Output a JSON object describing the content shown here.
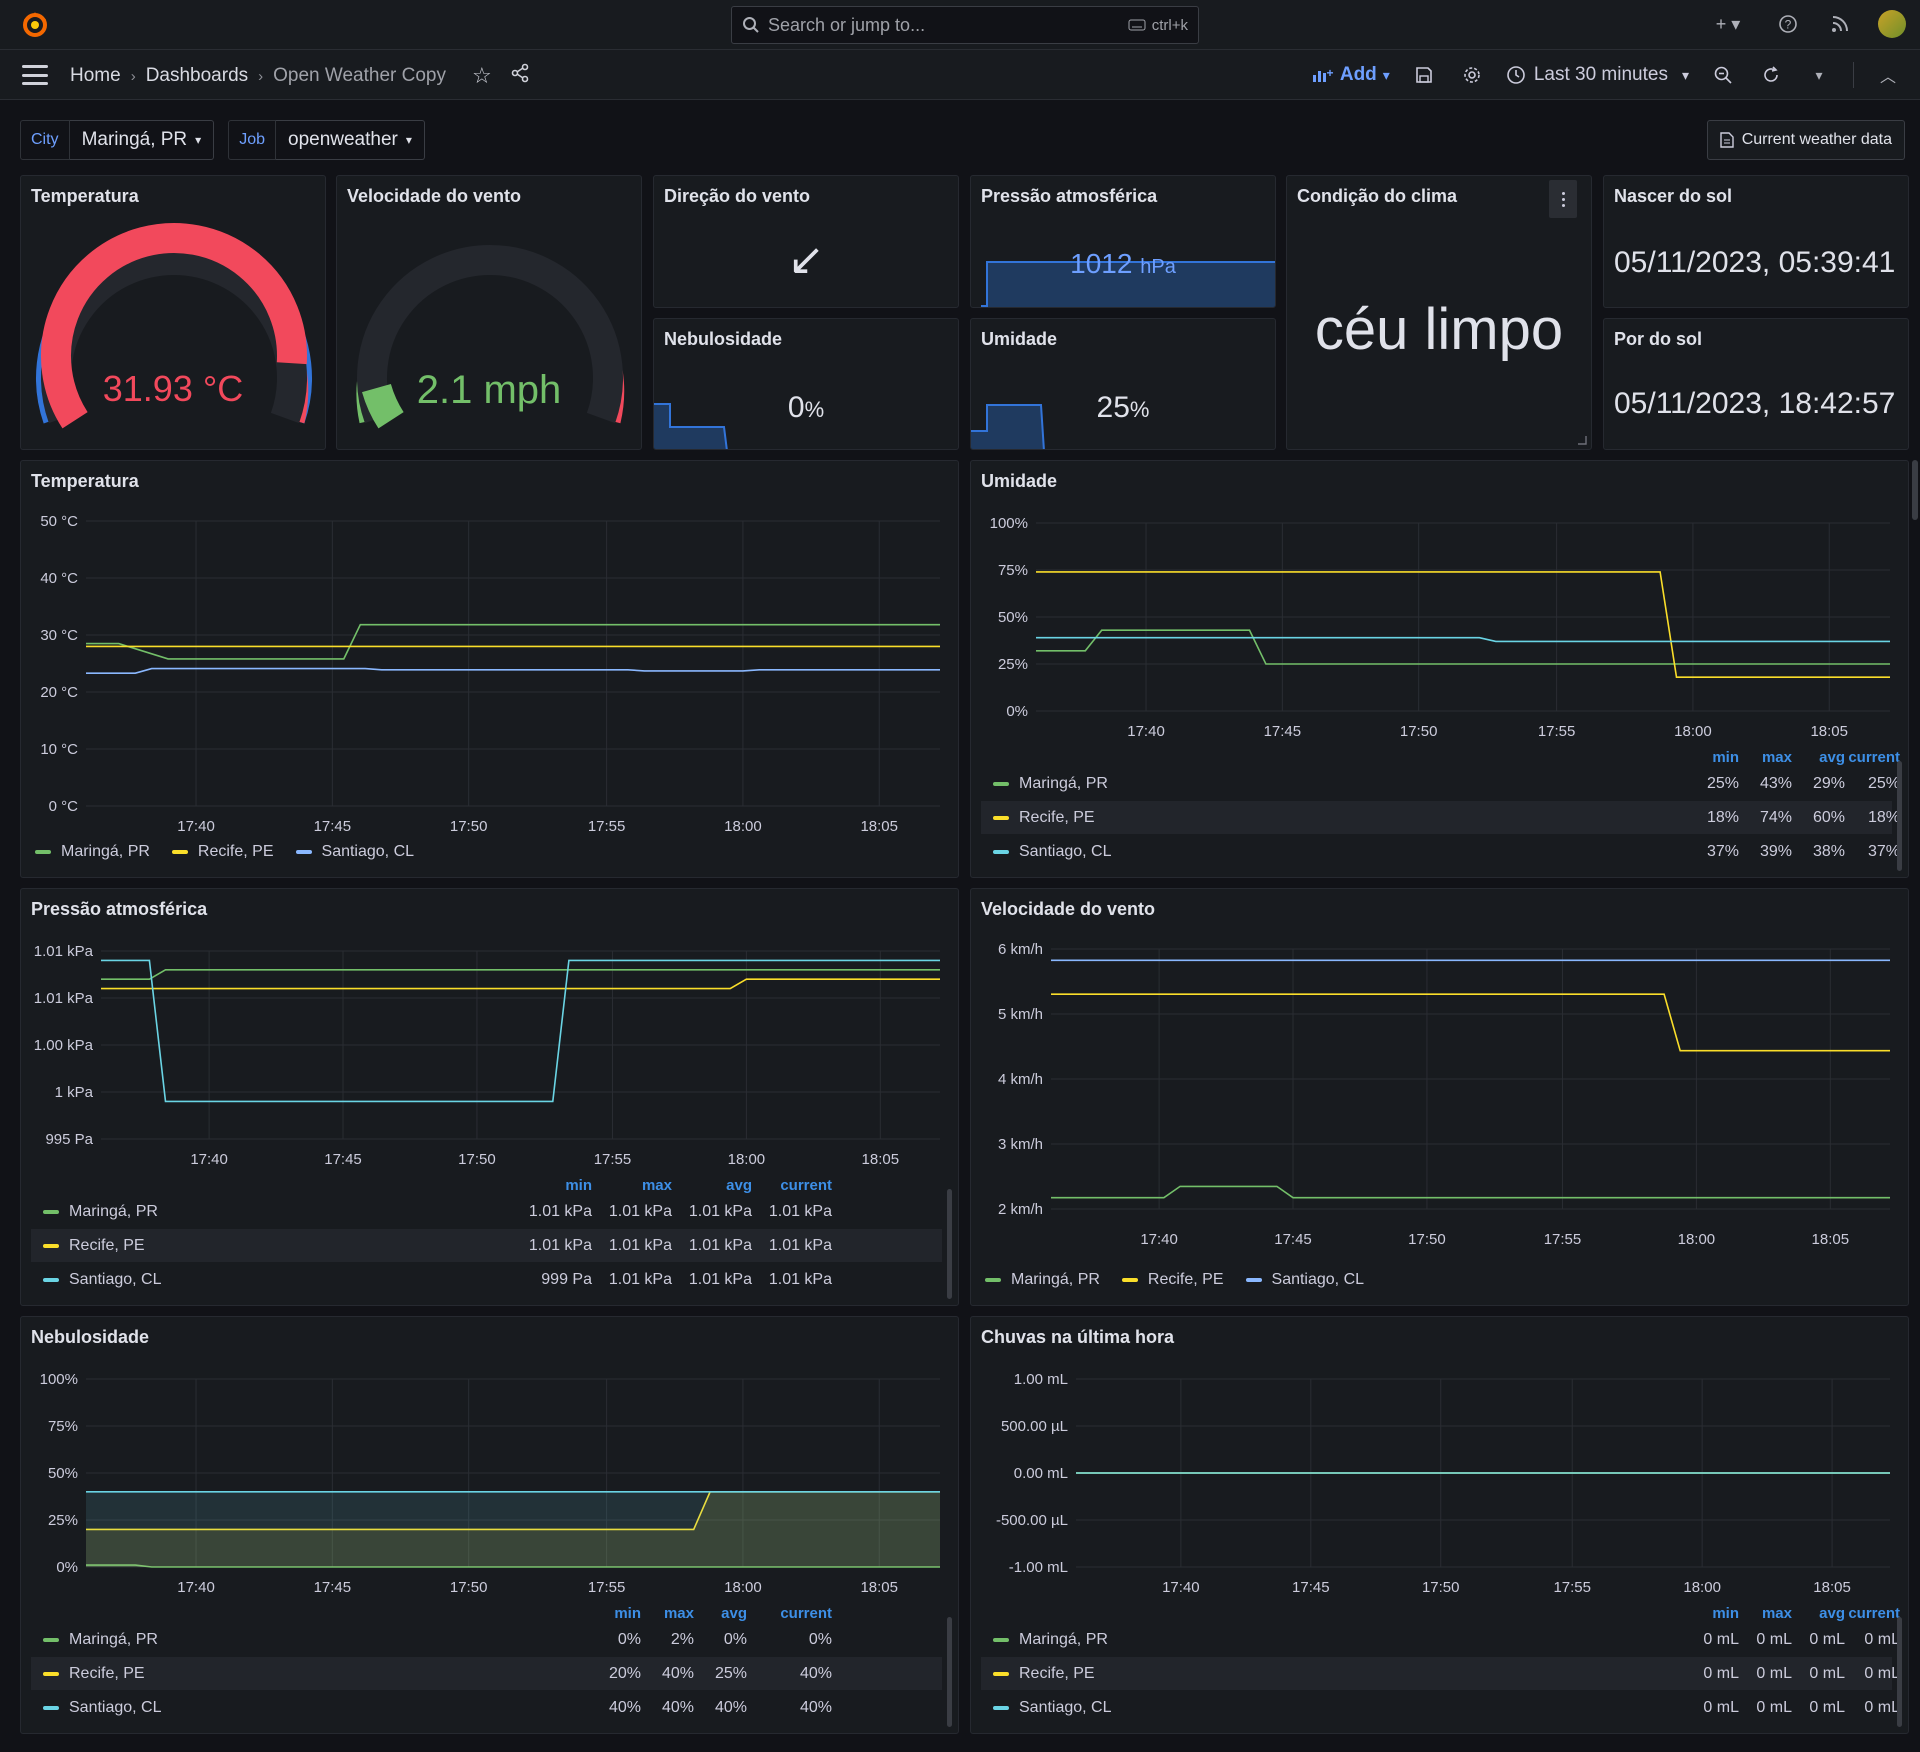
{
  "topbar": {
    "search_placeholder": "Search or jump to...",
    "search_shortcut": "ctrl+k"
  },
  "breadcrumb": {
    "home": "Home",
    "dashboards": "Dashboards",
    "current": "Open Weather Copy"
  },
  "toolbar": {
    "add_label": "Add",
    "time_range": "Last 30 minutes"
  },
  "variables": [
    {
      "label": "City",
      "value": "Maringá, PR"
    },
    {
      "label": "Job",
      "value": "openweather"
    }
  ],
  "link_button": "Current weather data",
  "panels": {
    "temp_gauge": {
      "title": "Temperatura",
      "value": "31.93 °C",
      "color": "#f2495c",
      "fraction": 0.88
    },
    "wind_gauge": {
      "title": "Velocidade do vento",
      "value": "2.1 mph",
      "color": "#73bf69",
      "fraction": 0.07
    },
    "wind_dir": {
      "title": "Direção do vento",
      "value": "↙"
    },
    "pressure_stat": {
      "title": "Pressão atmosférica",
      "value": "1012",
      "unit": "hPa"
    },
    "condition": {
      "title": "Condição do clima",
      "value": "céu limpo"
    },
    "sunrise": {
      "title": "Nascer do sol",
      "value": "05/11/2023, 05:39:41"
    },
    "cloud_stat": {
      "title": "Nebulosidade",
      "value": "0",
      "unit": "%"
    },
    "humidity_stat": {
      "title": "Umidade",
      "value": "25",
      "unit": "%"
    },
    "sunset": {
      "title": "Por do sol",
      "value": "05/11/2023, 18:42:57"
    }
  },
  "colors": {
    "green": "#73bf69",
    "yellow": "#fade2a",
    "blue": "#8ab8ff",
    "cyan": "#6ad4e4",
    "accent": "#3d8fe6"
  },
  "legend_columns": [
    "min",
    "max",
    "avg",
    "current"
  ],
  "chart_data": [
    {
      "id": "temperature",
      "type": "line",
      "title": "Temperatura",
      "x_ticks": [
        "17:40",
        "17:45",
        "17:50",
        "17:55",
        "18:00",
        "18:05"
      ],
      "y_ticks": [
        "50 °C",
        "40 °C",
        "30 °C",
        "20 °C",
        "10 °C",
        "0 °C"
      ],
      "ylim": [
        0,
        50
      ],
      "xlim": [
        17.6,
        18.12
      ],
      "series": [
        {
          "name": "Maringá, PR",
          "color": "#73bf69",
          "points": [
            [
              17.6,
              28.5
            ],
            [
              17.62,
              28.5
            ],
            [
              17.65,
              25.8
            ],
            [
              17.757,
              25.8
            ],
            [
              17.767,
              31.8
            ],
            [
              18.12,
              31.8
            ]
          ]
        },
        {
          "name": "Recife, PE",
          "color": "#fade2a",
          "points": [
            [
              17.6,
              28.0
            ],
            [
              18.12,
              28.0
            ]
          ]
        },
        {
          "name": "Santiago, CL",
          "color": "#8ab8ff",
          "points": [
            [
              17.6,
              23.3
            ],
            [
              17.63,
              23.3
            ],
            [
              17.64,
              24.1
            ],
            [
              17.77,
              24.1
            ],
            [
              17.78,
              23.9
            ],
            [
              17.93,
              23.9
            ],
            [
              17.94,
              23.7
            ],
            [
              18.0,
              23.7
            ],
            [
              18.01,
              23.9
            ],
            [
              18.12,
              23.9
            ]
          ]
        }
      ],
      "legend": [
        "Maringá, PR",
        "Recife, PE",
        "Santiago, CL"
      ]
    },
    {
      "id": "humidity",
      "type": "line",
      "title": "Umidade",
      "x_ticks": [
        "17:40",
        "17:45",
        "17:50",
        "17:55",
        "18:00",
        "18:05"
      ],
      "y_ticks": [
        "100%",
        "75%",
        "50%",
        "25%",
        "0%"
      ],
      "ylim": [
        0,
        100
      ],
      "xlim": [
        17.6,
        18.12
      ],
      "series": [
        {
          "name": "Maringá, PR",
          "color": "#73bf69",
          "points": [
            [
              17.6,
              32
            ],
            [
              17.63,
              32
            ],
            [
              17.64,
              43
            ],
            [
              17.73,
              43
            ],
            [
              17.74,
              25
            ],
            [
              18.12,
              25
            ]
          ]
        },
        {
          "name": "Recife, PE",
          "color": "#fade2a",
          "points": [
            [
              17.6,
              74
            ],
            [
              17.98,
              74
            ],
            [
              17.99,
              18
            ],
            [
              18.12,
              18
            ]
          ]
        },
        {
          "name": "Santiago, CL",
          "color": "#6ad4e4",
          "points": [
            [
              17.6,
              39
            ],
            [
              17.87,
              39
            ],
            [
              17.88,
              37
            ],
            [
              18.12,
              37
            ]
          ]
        }
      ],
      "table": [
        {
          "name": "Maringá, PR",
          "color": "#73bf69",
          "values": [
            "25%",
            "43%",
            "29%",
            "25%"
          ]
        },
        {
          "name": "Recife, PE",
          "color": "#fade2a",
          "values": [
            "18%",
            "74%",
            "60%",
            "18%"
          ]
        },
        {
          "name": "Santiago, CL",
          "color": "#6ad4e4",
          "values": [
            "37%",
            "39%",
            "38%",
            "37%"
          ]
        }
      ]
    },
    {
      "id": "pressure",
      "type": "line",
      "title": "Pressão atmosférica",
      "x_ticks": [
        "17:40",
        "17:45",
        "17:50",
        "17:55",
        "18:00",
        "18:05"
      ],
      "y_ticks": [
        "1.01 kPa",
        "1.01 kPa",
        "1.00 kPa",
        "1 kPa",
        "995 Pa"
      ],
      "ylim": [
        995,
        1015
      ],
      "xlim": [
        17.6,
        18.12
      ],
      "series": [
        {
          "name": "Maringá, PR",
          "color": "#73bf69",
          "points": [
            [
              17.6,
              1012
            ],
            [
              17.63,
              1012
            ],
            [
              17.64,
              1013
            ],
            [
              18.12,
              1013
            ]
          ]
        },
        {
          "name": "Recife, PE",
          "color": "#fade2a",
          "points": [
            [
              17.6,
              1011
            ],
            [
              17.99,
              1011
            ],
            [
              18.0,
              1012
            ],
            [
              18.12,
              1012
            ]
          ]
        },
        {
          "name": "Santiago, CL",
          "color": "#6ad4e4",
          "points": [
            [
              17.6,
              1014
            ],
            [
              17.63,
              1014
            ],
            [
              17.64,
              999
            ],
            [
              17.88,
              999
            ],
            [
              17.89,
              1014
            ],
            [
              18.12,
              1014
            ]
          ]
        }
      ],
      "table": [
        {
          "name": "Maringá, PR",
          "color": "#73bf69",
          "values": [
            "1.01 kPa",
            "1.01 kPa",
            "1.01 kPa",
            "1.01 kPa"
          ]
        },
        {
          "name": "Recife, PE",
          "color": "#fade2a",
          "values": [
            "1.01 kPa",
            "1.01 kPa",
            "1.01 kPa",
            "1.01 kPa"
          ]
        },
        {
          "name": "Santiago, CL",
          "color": "#6ad4e4",
          "values": [
            "999 Pa",
            "1.01 kPa",
            "1.01 kPa",
            "1.01 kPa"
          ]
        }
      ]
    },
    {
      "id": "wind",
      "type": "line",
      "title": "Velocidade do vento",
      "x_ticks": [
        "17:40",
        "17:45",
        "17:50",
        "17:55",
        "18:00",
        "18:05"
      ],
      "y_ticks": [
        "6 km/h",
        "5 km/h",
        "4 km/h",
        "3 km/h",
        "2 km/h"
      ],
      "ylim": [
        1.8,
        6.4
      ],
      "xlim": [
        17.6,
        18.12
      ],
      "series": [
        {
          "name": "Maringá, PR",
          "color": "#73bf69",
          "points": [
            [
              17.6,
              2.0
            ],
            [
              17.67,
              2.0
            ],
            [
              17.68,
              2.2
            ],
            [
              17.74,
              2.2
            ],
            [
              17.75,
              2.0
            ],
            [
              18.12,
              2.0
            ]
          ]
        },
        {
          "name": "Recife, PE",
          "color": "#fade2a",
          "points": [
            [
              17.6,
              5.6
            ],
            [
              17.98,
              5.6
            ],
            [
              17.99,
              4.6
            ],
            [
              18.12,
              4.6
            ]
          ]
        },
        {
          "name": "Santiago, CL",
          "color": "#8ab8ff",
          "points": [
            [
              17.6,
              6.2
            ],
            [
              18.12,
              6.2
            ]
          ]
        }
      ],
      "legend": [
        "Maringá, PR",
        "Recife, PE",
        "Santiago, CL"
      ]
    },
    {
      "id": "cloudiness",
      "type": "area",
      "title": "Nebulosidade",
      "x_ticks": [
        "17:40",
        "17:45",
        "17:50",
        "17:55",
        "18:00",
        "18:05"
      ],
      "y_ticks": [
        "100%",
        "75%",
        "50%",
        "25%",
        "0%"
      ],
      "ylim": [
        0,
        100
      ],
      "xlim": [
        17.6,
        18.12
      ],
      "series": [
        {
          "name": "Maringá, PR",
          "color": "#73bf69",
          "points": [
            [
              17.6,
              1
            ],
            [
              17.63,
              1
            ],
            [
              17.64,
              0
            ],
            [
              18.12,
              0
            ]
          ]
        },
        {
          "name": "Recife, PE",
          "color": "#fade2a",
          "points": [
            [
              17.6,
              20
            ],
            [
              17.97,
              20
            ],
            [
              17.98,
              40
            ],
            [
              18.12,
              40
            ]
          ]
        },
        {
          "name": "Santiago, CL",
          "color": "#6ad4e4",
          "points": [
            [
              17.6,
              40
            ],
            [
              18.12,
              40
            ]
          ]
        }
      ],
      "table": [
        {
          "name": "Maringá, PR",
          "color": "#73bf69",
          "values": [
            "0%",
            "2%",
            "0%",
            "0%"
          ]
        },
        {
          "name": "Recife, PE",
          "color": "#fade2a",
          "values": [
            "20%",
            "40%",
            "25%",
            "40%"
          ]
        },
        {
          "name": "Santiago, CL",
          "color": "#6ad4e4",
          "values": [
            "40%",
            "40%",
            "40%",
            "40%"
          ]
        }
      ]
    },
    {
      "id": "rain",
      "type": "line",
      "title": "Chuvas na última hora",
      "x_ticks": [
        "17:40",
        "17:45",
        "17:50",
        "17:55",
        "18:00",
        "18:05"
      ],
      "y_ticks": [
        "1.00 mL",
        "500.00 µL",
        "0.00 mL",
        "-500.00 µL",
        "-1.00 mL"
      ],
      "ylim": [
        -1,
        1
      ],
      "xlim": [
        17.6,
        18.12
      ],
      "series": [
        {
          "name": "Maringá, PR",
          "color": "#73bf69",
          "points": [
            [
              17.6,
              0
            ],
            [
              18.12,
              0
            ]
          ]
        },
        {
          "name": "Recife, PE",
          "color": "#fade2a",
          "points": [
            [
              17.6,
              0
            ],
            [
              18.12,
              0
            ]
          ]
        },
        {
          "name": "Santiago, CL",
          "color": "#6ad4e4",
          "points": [
            [
              17.6,
              0
            ],
            [
              18.12,
              0
            ]
          ]
        }
      ],
      "table": [
        {
          "name": "Maringá, PR",
          "color": "#73bf69",
          "values": [
            "0 mL",
            "0 mL",
            "0 mL",
            "0 mL"
          ]
        },
        {
          "name": "Recife, PE",
          "color": "#fade2a",
          "values": [
            "0 mL",
            "0 mL",
            "0 mL",
            "0 mL"
          ]
        },
        {
          "name": "Santiago, CL",
          "color": "#6ad4e4",
          "values": [
            "0 mL",
            "0 mL",
            "0 mL",
            "0 mL"
          ]
        }
      ]
    }
  ]
}
